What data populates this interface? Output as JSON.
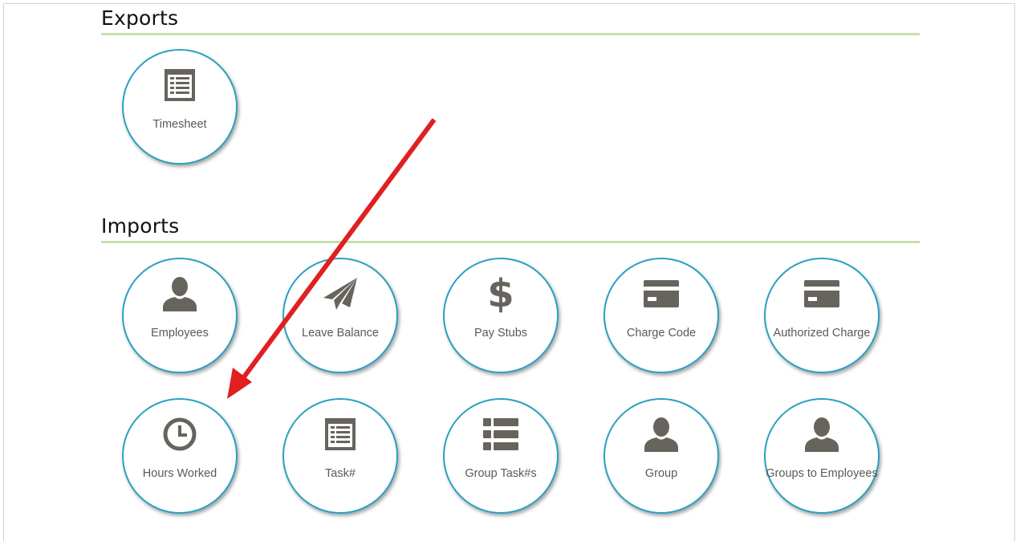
{
  "exports": {
    "title": "Exports",
    "tiles": [
      {
        "label": "Timesheet",
        "icon": "list-alt-icon"
      }
    ]
  },
  "imports": {
    "title": "Imports",
    "tiles": [
      {
        "label": "Employees",
        "icon": "user-icon"
      },
      {
        "label": "Leave Balance",
        "icon": "paper-plane-icon"
      },
      {
        "label": "Pay Stubs",
        "icon": "dollar-icon"
      },
      {
        "label": "Charge Code",
        "icon": "credit-card-icon"
      },
      {
        "label": "Authorized Charge",
        "icon": "credit-card-icon"
      },
      {
        "label": "Hours Worked",
        "icon": "clock-icon"
      },
      {
        "label": "Task#",
        "icon": "list-alt-icon"
      },
      {
        "label": "Group Task#s",
        "icon": "list-icon"
      },
      {
        "label": "Group",
        "icon": "user-icon"
      },
      {
        "label": "Groups to Employees",
        "icon": "user-icon"
      }
    ]
  },
  "icon_glyphs": {
    "dollar": "$"
  },
  "colors": {
    "tile_border": "#2aa0c3",
    "icon": "#66645c",
    "rule": "#c7dfb0",
    "annotation_arrow": "#e02020"
  }
}
